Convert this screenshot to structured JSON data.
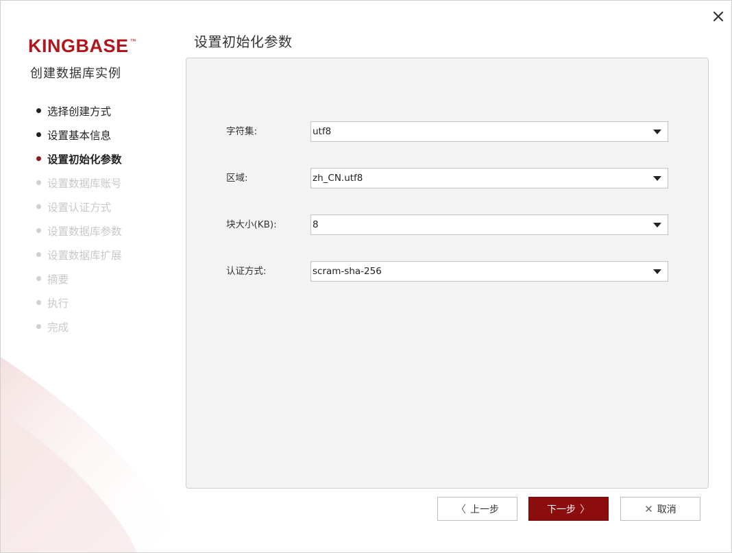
{
  "header": {
    "close_label": "✕"
  },
  "logo": {
    "text": "KINGBASE",
    "tm": "™"
  },
  "wizard": {
    "title": "创建数据库实例"
  },
  "steps": [
    {
      "label": "选择创建方式",
      "state": "done"
    },
    {
      "label": "设置基本信息",
      "state": "done"
    },
    {
      "label": "设置初始化参数",
      "state": "current"
    },
    {
      "label": "设置数据库账号",
      "state": "pending"
    },
    {
      "label": "设置认证方式",
      "state": "pending"
    },
    {
      "label": "设置数据库参数",
      "state": "pending"
    },
    {
      "label": "设置数据库扩展",
      "state": "pending"
    },
    {
      "label": "摘要",
      "state": "pending"
    },
    {
      "label": "执行",
      "state": "pending"
    },
    {
      "label": "完成",
      "state": "pending"
    }
  ],
  "page": {
    "title": "设置初始化参数"
  },
  "form": {
    "charset": {
      "label": "字符集:",
      "value": "utf8"
    },
    "locale": {
      "label": "区域:",
      "value": "zh_CN.utf8"
    },
    "block_size": {
      "label": "块大小(KB):",
      "value": "8"
    },
    "auth": {
      "label": "认证方式:",
      "value": "scram-sha-256"
    }
  },
  "buttons": {
    "prev": {
      "chev": "〈",
      "label": "上一步"
    },
    "next": {
      "label": "下一步",
      "chev": "〉"
    },
    "cancel": {
      "icon": "✕",
      "label": "取消"
    }
  },
  "colors": {
    "brand": "#b0161b",
    "primary_button": "#8b0d0d",
    "current_step_dot": "#8b1a1a"
  }
}
